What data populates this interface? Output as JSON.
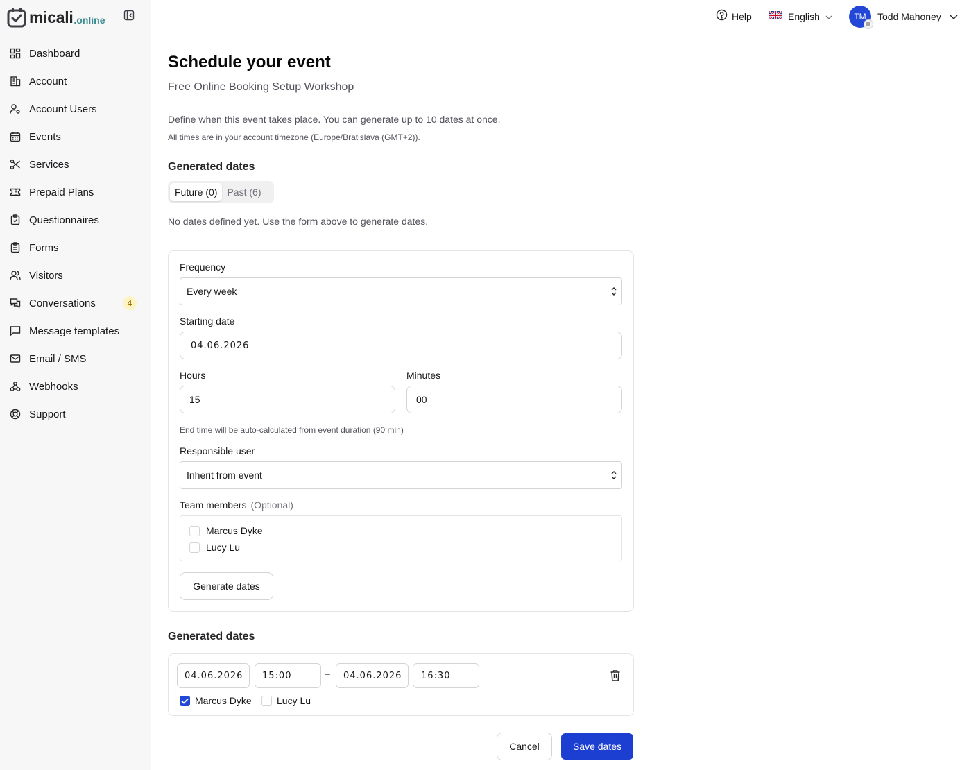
{
  "brand": {
    "name": "micali",
    "suffix": ".online"
  },
  "sidebar": {
    "items": [
      {
        "label": "Dashboard",
        "icon": "dashboard-icon"
      },
      {
        "label": "Account",
        "icon": "building-icon"
      },
      {
        "label": "Account Users",
        "icon": "user-cog-icon"
      },
      {
        "label": "Events",
        "icon": "calendar-icon"
      },
      {
        "label": "Services",
        "icon": "scissors-icon"
      },
      {
        "label": "Prepaid Plans",
        "icon": "ticket-icon"
      },
      {
        "label": "Questionnaires",
        "icon": "clipboard-check-icon"
      },
      {
        "label": "Forms",
        "icon": "clipboard-list-icon"
      },
      {
        "label": "Visitors",
        "icon": "users-icon"
      },
      {
        "label": "Conversations",
        "icon": "chat-icon",
        "badge": "4"
      },
      {
        "label": "Message templates",
        "icon": "message-square-icon"
      },
      {
        "label": "Email / SMS",
        "icon": "mail-icon"
      },
      {
        "label": "Webhooks",
        "icon": "webhook-icon"
      },
      {
        "label": "Support",
        "icon": "lifebuoy-icon"
      }
    ]
  },
  "header": {
    "help": "Help",
    "language": "English",
    "user_initials": "TM",
    "user_name": "Todd Mahoney"
  },
  "page": {
    "title": "Schedule your event",
    "subtitle": "Free Online Booking Setup Workshop",
    "description": "Define when this event takes place. You can generate up to 10 dates at once.",
    "timezone_note": "All times are in your account timezone (Europe/Bratislava (GMT+2)).",
    "generated_heading": "Generated dates",
    "tabs": [
      {
        "label": "Future (0)",
        "active": true
      },
      {
        "label": "Past (6)",
        "active": false
      }
    ],
    "empty_message": "No dates defined yet. Use the form above to generate dates."
  },
  "form": {
    "frequency_label": "Frequency",
    "frequency_value": "Every week",
    "start_label": "Starting date",
    "start_value": "04.06.2026",
    "hours_label": "Hours",
    "hours_value": "15",
    "minutes_label": "Minutes",
    "minutes_value": "00",
    "end_hint": "End time will be auto-calculated from event duration (90 min)",
    "responsible_label": "Responsible user",
    "responsible_value": "Inherit from event",
    "team_label": "Team members",
    "team_optional": "(Optional)",
    "team_members": [
      {
        "name": "Marcus Dyke",
        "checked": false
      },
      {
        "name": "Lucy Lu",
        "checked": false
      }
    ],
    "generate_button": "Generate dates"
  },
  "generated": {
    "heading": "Generated dates",
    "rows": [
      {
        "start_date": "04.06.2026",
        "start_time": "15:00",
        "separator": "–",
        "end_date": "04.06.2026",
        "end_time": "16:30",
        "members": [
          {
            "name": "Marcus Dyke",
            "checked": true
          },
          {
            "name": "Lucy Lu",
            "checked": false
          }
        ]
      }
    ]
  },
  "actions": {
    "cancel": "Cancel",
    "save": "Save dates"
  },
  "colors": {
    "primary": "#1d3fd1",
    "badge_bg": "#fdf3c4",
    "sidebar_bg": "#f7f7f8",
    "brand_accent": "#3b8a8f"
  }
}
